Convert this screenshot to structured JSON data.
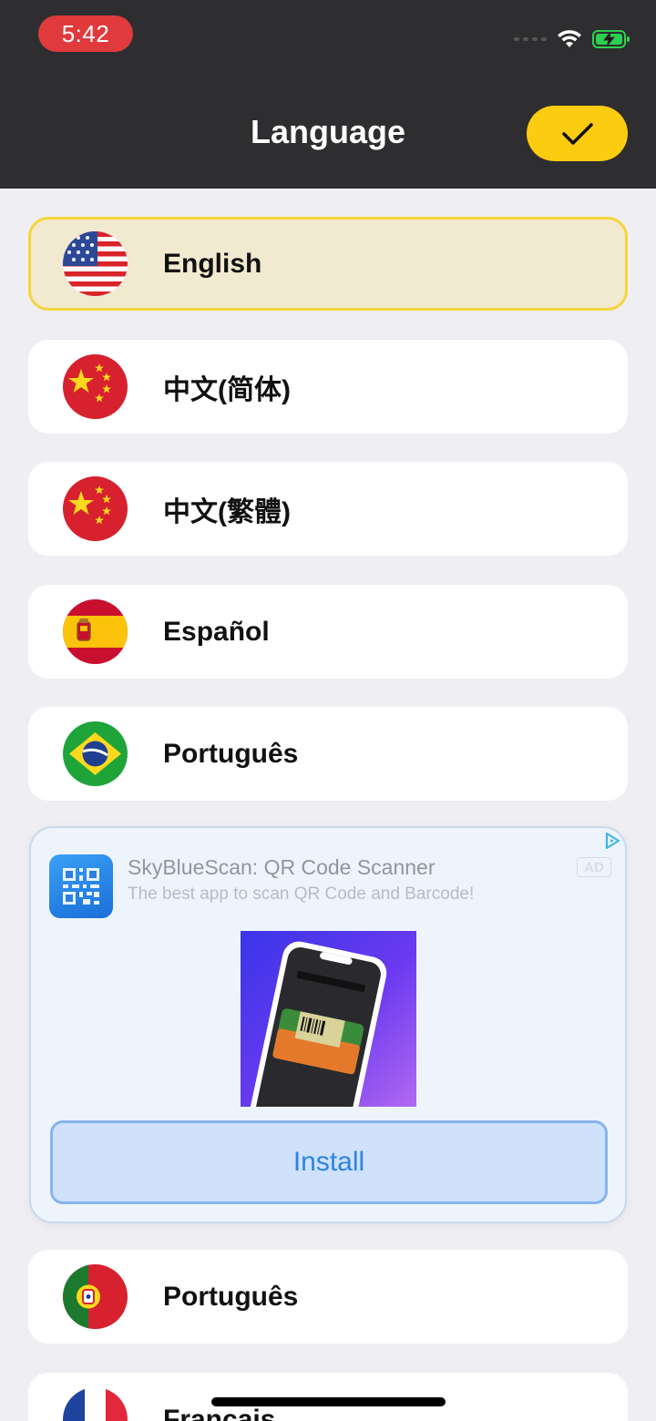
{
  "status_bar": {
    "time": "5:42"
  },
  "header": {
    "title": "Language",
    "confirm_icon": "checkmark-icon"
  },
  "languages": [
    {
      "label": "English",
      "flag": "us-flag-icon",
      "selected": true
    },
    {
      "label": "中文(简体)",
      "flag": "china-flag-icon",
      "selected": false
    },
    {
      "label": "中文(繁體)",
      "flag": "china-flag-icon",
      "selected": false
    },
    {
      "label": "Español",
      "flag": "spain-flag-icon",
      "selected": false
    },
    {
      "label": "Português",
      "flag": "brazil-flag-icon",
      "selected": false
    },
    {
      "label": "Português",
      "flag": "portugal-flag-icon",
      "selected": false
    },
    {
      "label": "Français",
      "flag": "france-flag-icon",
      "selected": false
    }
  ],
  "ad": {
    "badge": "AD",
    "app_name": "SkyBlueScan: QR Code Scanner",
    "description": "The best app to scan QR Code and Barcode!",
    "install_label": "Install"
  },
  "colors": {
    "header_bg": "#2e2d30",
    "accent": "#fccc10",
    "selected_bg": "#f1ead0",
    "install_text": "#2b84e6"
  }
}
